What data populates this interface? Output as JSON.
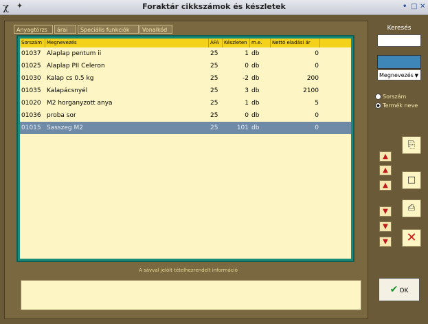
{
  "window": {
    "title": "Foraktár cikkszámok és készletek"
  },
  "tabs": [
    "Anyagtörzs",
    "árai",
    "Speciális funkciók",
    "Vonalkód"
  ],
  "table": {
    "columns": [
      "Sorszám",
      "Megnevezés",
      "ÁFA",
      "Készleten",
      "m.e.",
      "Nettó eladási ár"
    ],
    "rows": [
      {
        "sorszam": "01037",
        "megnevezes": "Alaplap pentum ii",
        "afa": "25",
        "keszlet": "1",
        "me": "db",
        "ar": "0",
        "selected": false
      },
      {
        "sorszam": "01025",
        "megnevezes": "Alaplap PII Celeron",
        "afa": "25",
        "keszlet": "0",
        "me": "db",
        "ar": "0",
        "selected": false
      },
      {
        "sorszam": "01030",
        "megnevezes": "Kalap cs 0.5 kg",
        "afa": "25",
        "keszlet": "-2",
        "me": "db",
        "ar": "200",
        "selected": false
      },
      {
        "sorszam": "01035",
        "megnevezes": "Kalapácsnyél",
        "afa": "25",
        "keszlet": "3",
        "me": "db",
        "ar": "2100",
        "selected": false
      },
      {
        "sorszam": "01020",
        "megnevezes": "M2 horganyzott anya",
        "afa": "25",
        "keszlet": "1",
        "me": "db",
        "ar": "5",
        "selected": false
      },
      {
        "sorszam": "01036",
        "megnevezes": "proba sor",
        "afa": "25",
        "keszlet": "0",
        "me": "db",
        "ar": "0",
        "selected": false
      },
      {
        "sorszam": "01015",
        "megnevezes": "Sasszeg M2",
        "afa": "25",
        "keszlet": "101",
        "me": "db",
        "ar": "0",
        "selected": true
      }
    ]
  },
  "info": {
    "label": "A sávval jelölt tételhezrendelt információ"
  },
  "search": {
    "label": "Keresés",
    "value": ""
  },
  "sortselect": {
    "value": "Megnevezés"
  },
  "radios": [
    {
      "label": "Sorszám",
      "checked": false
    },
    {
      "label": "Termék neve",
      "checked": true
    }
  ],
  "ok": {
    "label": "OK"
  },
  "icons": {
    "up": "arrow-up-icon",
    "down": "arrow-down-icon",
    "copy": "copy-icon",
    "new": "new-document-icon",
    "print": "print-icon",
    "delete": "delete-icon"
  },
  "colors": {
    "header": "#f4d21a",
    "grid_bg": "#fdf6c4",
    "selection": "#6e8aa6",
    "frame": "#1a8a7a",
    "delete": "#d01818"
  }
}
